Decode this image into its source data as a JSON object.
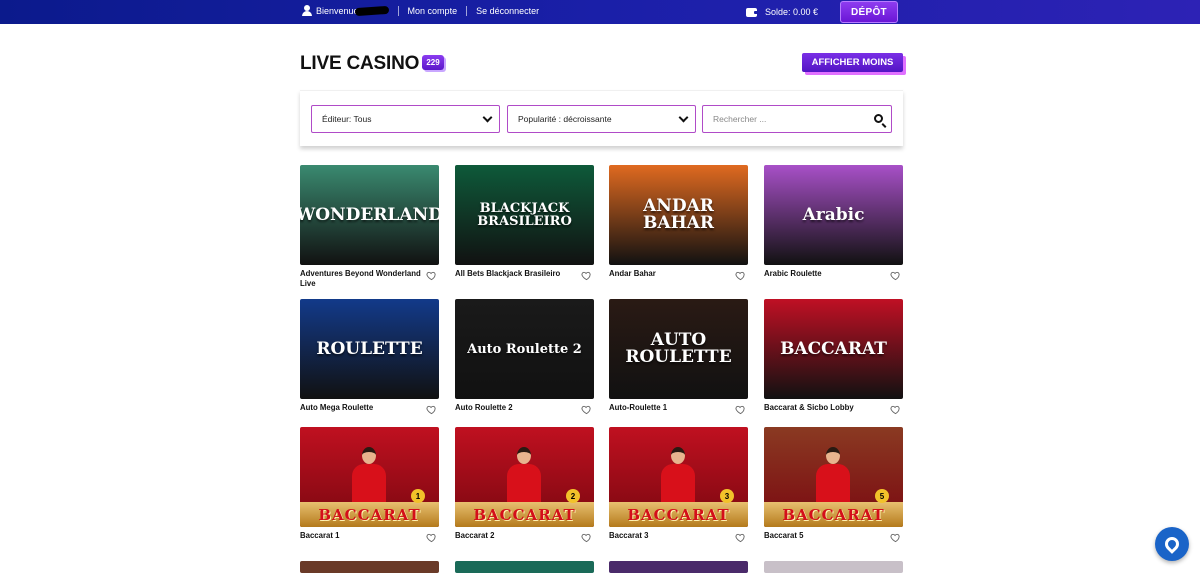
{
  "topbar": {
    "greeting": "Bienvenue",
    "account_link": "Mon compte",
    "logout_link": "Se déconnecter",
    "balance": "Solde: 0.00 €",
    "deposit_button": "DÉPÔT"
  },
  "header": {
    "title": "LIVE CASINO",
    "count": "229",
    "toggle_button": "AFFICHER MOINS"
  },
  "filters": {
    "editor": "Éditeur: Tous",
    "sort": "Popularité : décroissante",
    "search_placeholder": "Rechercher ..."
  },
  "games": [
    {
      "name": "Adventures Beyond Wonderland Live",
      "art": "WONDERLAND",
      "bg": "#3a8a70"
    },
    {
      "name": "All Bets Blackjack Brasileiro",
      "art": "BLACKJACK BRASILEIRO",
      "bg": "#0e5a3a"
    },
    {
      "name": "Andar Bahar",
      "art": "ANDAR BAHAR",
      "bg": "#e06a20"
    },
    {
      "name": "Arabic Roulette",
      "art": "Arabic",
      "bg": "#a850c8"
    },
    {
      "name": "Auto Mega Roulette",
      "art": "ROULETTE",
      "bg": "#123a8a"
    },
    {
      "name": "Auto Roulette 2",
      "art": "Auto Roulette 2",
      "bg": "#1a1a1a"
    },
    {
      "name": "Auto-Roulette 1",
      "art": "AUTO ROULETTE",
      "bg": "#2a1a14"
    },
    {
      "name": "Baccarat & Sicbo Lobby",
      "art": "BACCARAT",
      "bg": "#c01024"
    },
    {
      "name": "Baccarat 1",
      "art": "BACCARAT",
      "num": "1",
      "bg": "#c01020"
    },
    {
      "name": "Baccarat 2",
      "art": "BACCARAT",
      "num": "2",
      "bg": "#c01020"
    },
    {
      "name": "Baccarat 3",
      "art": "BACCARAT",
      "num": "3",
      "bg": "#c01020"
    },
    {
      "name": "Baccarat 5",
      "art": "BACCARAT",
      "num": "5",
      "bg": "#8a3a22"
    }
  ],
  "colors": {
    "accent": "#6a16d6",
    "topbar": "#1a1fa8",
    "chat": "#1a64c8"
  }
}
